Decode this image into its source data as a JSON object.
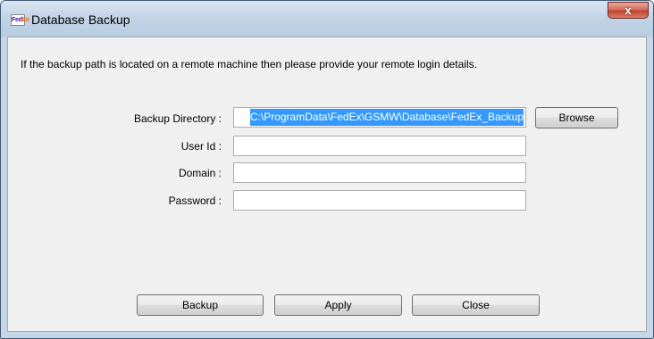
{
  "window": {
    "title": "Database Backup",
    "close_glyph": "x",
    "icon": {
      "part1": "Fed",
      "part2": "Ex"
    }
  },
  "info_text": "If the backup path is located on a remote machine then please provide your remote login details.",
  "form": {
    "backup_directory": {
      "label": "Backup Directory :",
      "value": "C:\\ProgramData\\FedEx\\GSMW\\Database\\FedEx_Backup"
    },
    "user_id": {
      "label": "User Id :",
      "value": ""
    },
    "domain": {
      "label": "Domain :",
      "value": ""
    },
    "password": {
      "label": "Password :",
      "value": ""
    },
    "browse_label": "Browse"
  },
  "buttons": {
    "backup": "Backup",
    "apply": "Apply",
    "close": "Close"
  },
  "colors": {
    "selection": "#3399ff",
    "window_frame": "#c7d6e6",
    "client_bg": "#f0f0f0"
  }
}
